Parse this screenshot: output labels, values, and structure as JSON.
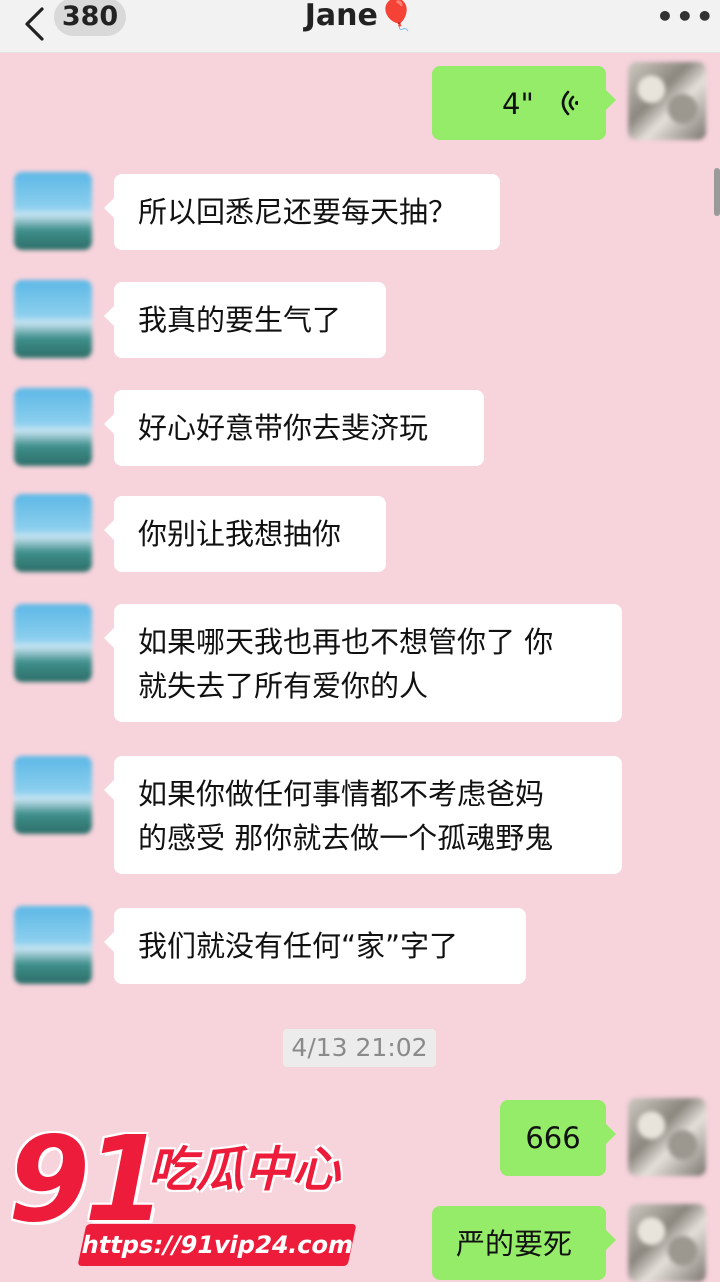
{
  "header": {
    "unread_count": "380",
    "title": "Jane🎈"
  },
  "messages": [
    {
      "side": "right",
      "type": "voice",
      "duration": "4\""
    },
    {
      "side": "left",
      "text": "所以回悉尼还要每天抽？"
    },
    {
      "side": "left",
      "text": "我真的要生气了"
    },
    {
      "side": "left",
      "text": "好心好意带你去斐济玩"
    },
    {
      "side": "left",
      "text": "你别让我想抽你"
    },
    {
      "side": "left",
      "lines": [
        "如果哪天我也再也不想管你了 你",
        "就失去了所有爱你的人"
      ]
    },
    {
      "side": "left",
      "lines": [
        "如果你做任何事情都不考虑爸妈",
        "的感受 那你就去做一个孤魂野鬼"
      ]
    },
    {
      "side": "left",
      "text": "我们就没有任何“家”字了"
    },
    {
      "type": "timestamp",
      "text": "4/13 21:02"
    },
    {
      "side": "right",
      "text": "666"
    },
    {
      "side": "right",
      "text": "严的要死"
    }
  ],
  "watermark": {
    "number": "91",
    "brand": "吃瓜中心",
    "url": "https://91vip24.com"
  },
  "colors": {
    "background": "#f7d3dc",
    "sent_bubble": "#95ec69",
    "received_bubble": "#ffffff",
    "watermark": "#ee1c3b"
  }
}
